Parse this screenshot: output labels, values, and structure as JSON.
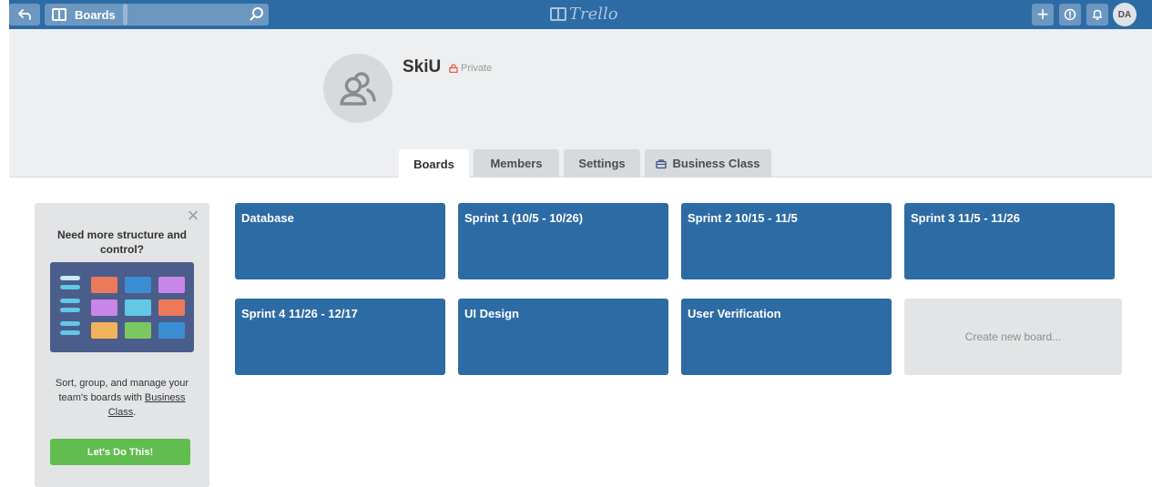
{
  "topbar": {
    "boards_label": "Boards",
    "search_value": "",
    "logo_text": "Trello",
    "plus_label": "+",
    "avatar_initials": "DA"
  },
  "team": {
    "name": "SkiU",
    "visibility": "Private"
  },
  "tabs": [
    {
      "label": "Boards",
      "active": true
    },
    {
      "label": "Members",
      "active": false
    },
    {
      "label": "Settings",
      "active": false
    },
    {
      "label": "Business Class",
      "active": false
    }
  ],
  "promo": {
    "close_symbol": "×",
    "title": "Need more structure and control?",
    "text_before": "Sort, group, and manage your team's boards with",
    "link_text": "Business Class",
    "text_after": ".",
    "button_label": "Let's Do This!"
  },
  "boards": [
    {
      "title": "Database"
    },
    {
      "title": "Sprint 1 (10/5 - 10/26)"
    },
    {
      "title": "Sprint 2 10/15 - 11/5"
    },
    {
      "title": "Sprint 3 11/5 - 11/26"
    },
    {
      "title": "Sprint 4 11/26 - 12/17"
    },
    {
      "title": "UI Design"
    },
    {
      "title": "User Verification"
    }
  ],
  "create_board_label": "Create new board...",
  "colors": {
    "header_blue": "#2d6ba5",
    "board_blue": "#2d6ba5",
    "button_green": "#61bd4f",
    "private_red": "#eb5a46"
  }
}
